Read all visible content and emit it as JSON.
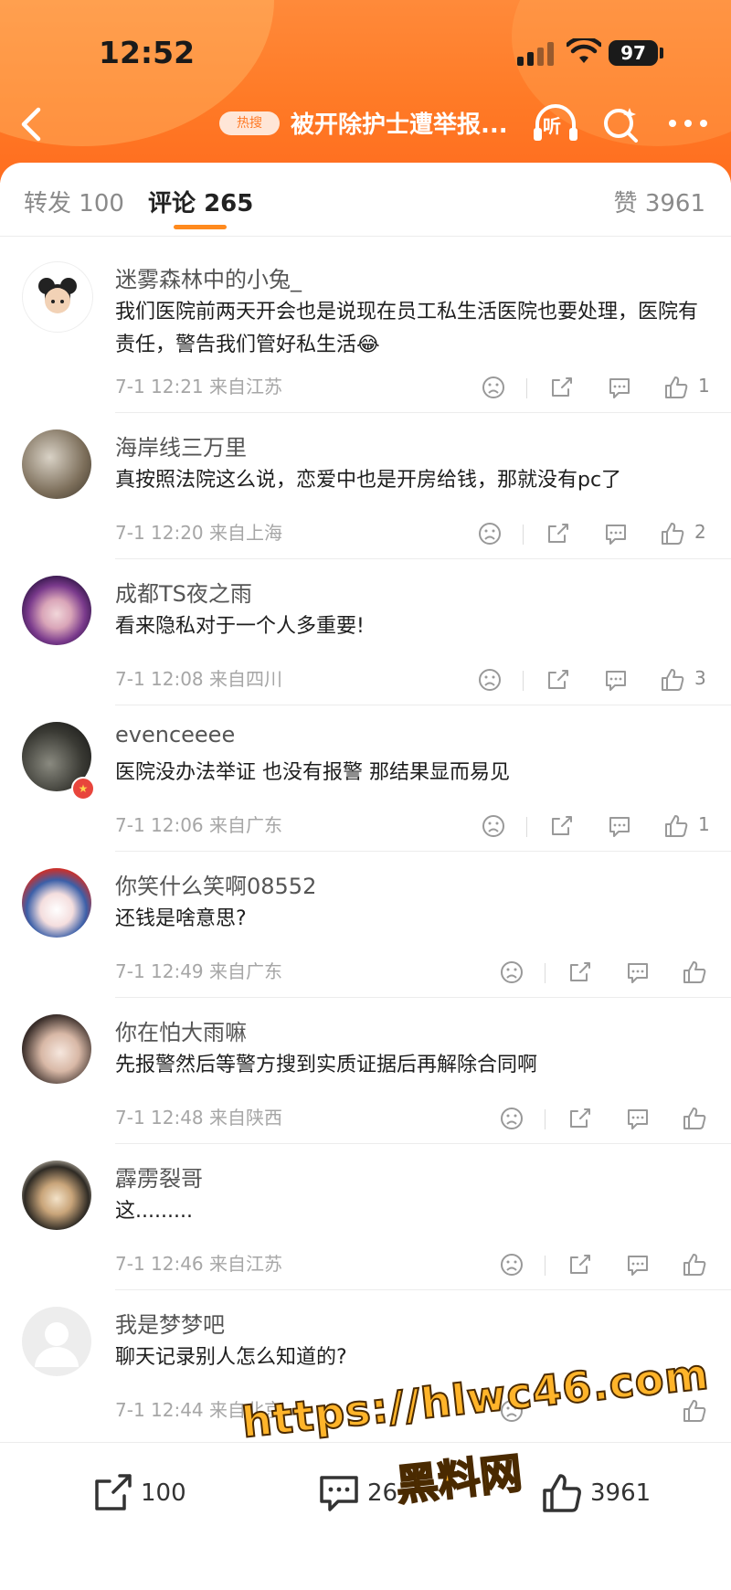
{
  "status_bar": {
    "time": "12:52",
    "battery": "97"
  },
  "nav": {
    "hot_badge": "热搜",
    "title": "被开除护士遭举报...",
    "listen_label": "听"
  },
  "tabs": [
    {
      "label": "转发",
      "count": "100"
    },
    {
      "label": "评论",
      "count": "265"
    },
    {
      "label": "赞",
      "count": "3961"
    }
  ],
  "comments": [
    {
      "name": "迷雾森林中的小兔_",
      "text": "我们医院前两天开会也是说现在员工私生活医院也要处理，医院有责任，警告我们管好私生活😂",
      "time": "7-1 12:21",
      "location": "来自江苏",
      "likes": "1"
    },
    {
      "name": "海岸线三万里",
      "text": "真按照法院这么说，恋爱中也是开房给钱，那就没有pc了",
      "time": "7-1 12:20",
      "location": "来自上海",
      "likes": "2"
    },
    {
      "name": "成都TS夜之雨",
      "text": "看来隐私对于一个人多重要!",
      "time": "7-1 12:08",
      "location": "来自四川",
      "likes": "3"
    },
    {
      "name": "evenceeee",
      "text": "医院没办法举证 也没有报警 那结果显而易见",
      "time": "7-1 12:06",
      "location": "来自广东",
      "likes": "1"
    },
    {
      "name": "你笑什么笑啊08552",
      "text": "还钱是啥意思?",
      "time": "7-1 12:49",
      "location": "来自广东",
      "likes": ""
    },
    {
      "name": "你在怕大雨嘛",
      "text": "先报警然后等警方搜到实质证据后再解除合同啊",
      "time": "7-1 12:48",
      "location": "来自陕西",
      "likes": ""
    },
    {
      "name": "霹雳裂哥",
      "text": "这.........",
      "time": "7-1 12:46",
      "location": "来自江苏",
      "likes": ""
    },
    {
      "name": "我是梦梦吧",
      "text": "聊天记录别人怎么知道的?",
      "time": "7-1 12:44",
      "location": "来自北京",
      "likes": ""
    }
  ],
  "bottom_bar": {
    "repost_count": "100",
    "comment_count": "26",
    "like_count": "3961"
  },
  "watermark": {
    "url": "https://hlwc46.com",
    "name": "黑料网"
  },
  "colors": {
    "accent": "#ff7a26",
    "underline": "#ff8a1e",
    "watermark": "#ffb42a"
  }
}
